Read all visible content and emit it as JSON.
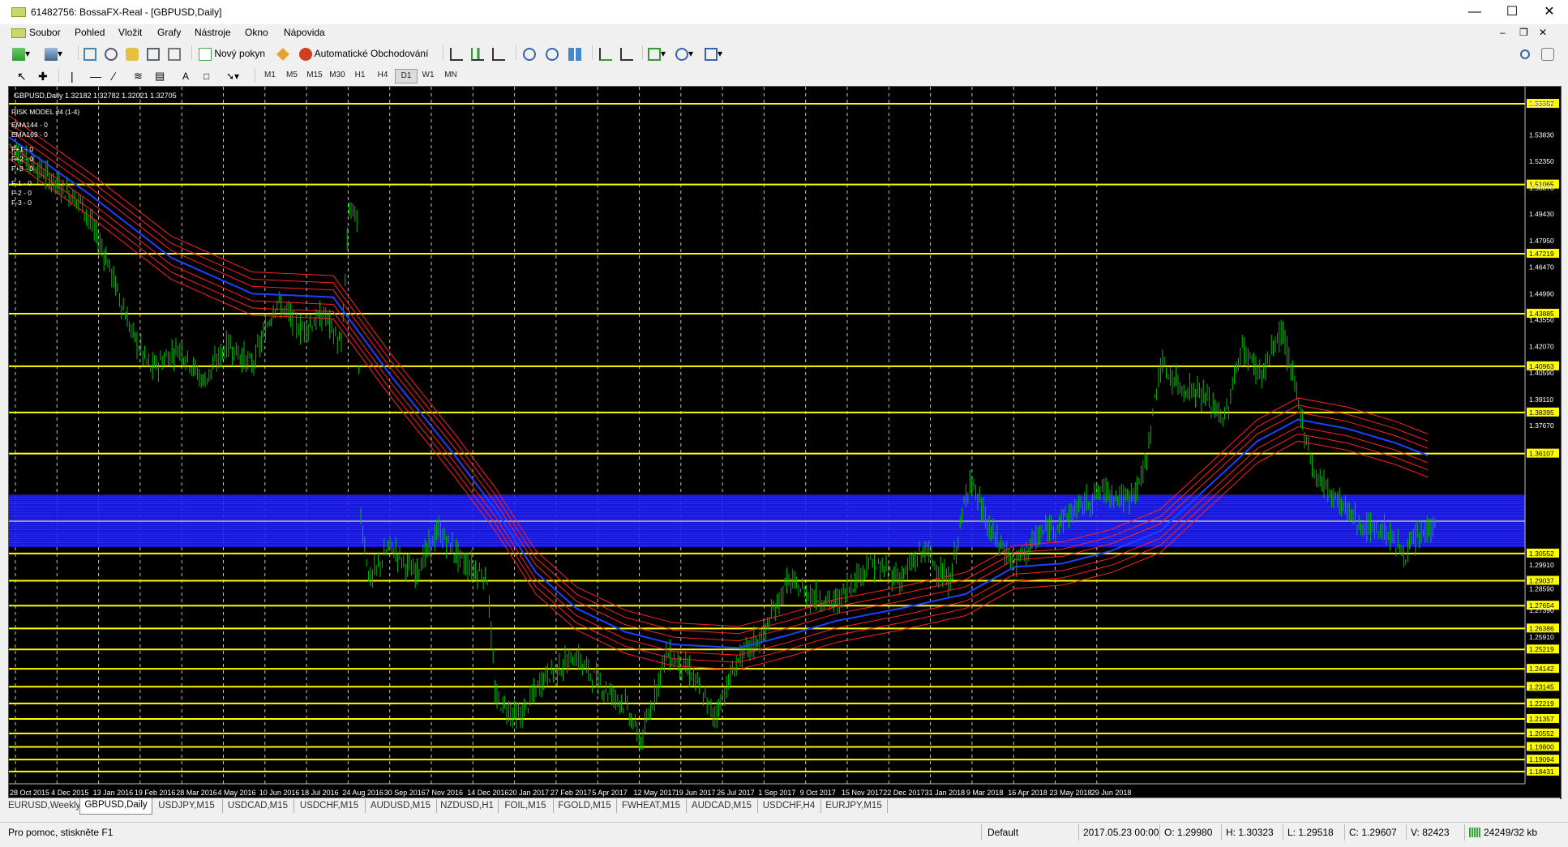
{
  "window": {
    "title": "61482756: BossaFX-Real - [GBPUSD,Daily]"
  },
  "menu": {
    "items": [
      "Soubor",
      "Pohled",
      "Vložit",
      "Grafy",
      "Nástroje",
      "Okno",
      "Nápovida"
    ]
  },
  "toolbar": {
    "new_order": "Nový pokyn",
    "auto_trading": "Automatické Obchodování"
  },
  "timeframes": [
    "M1",
    "M5",
    "M15",
    "M30",
    "H1",
    "H4",
    "D1",
    "W1",
    "MN"
  ],
  "active_timeframe": "D1",
  "chart": {
    "header": "GBPUSD,Daily  1.32182 1.32782 1.32021 1.32705",
    "indicators": [
      "RISK MODEL #4 (1-4)",
      "EMA144 - 0",
      "EMA169 - 0",
      "F+1 - 0",
      "F+2 - 0",
      "F+3 - 0",
      "F-1 - 0",
      "F-2 - 0",
      "F-3 - 0"
    ],
    "price_labels": [
      "1.55552",
      "1.55510",
      "1.53830",
      "1.52350",
      "1.51065",
      "1.50870",
      "1.49430",
      "1.47950",
      "1.47219",
      "1.46470",
      "1.44990",
      "1.43885",
      "1.43550",
      "1.42070",
      "1.40963",
      "1.40590",
      "1.39110",
      "1.38395",
      "1.37670",
      "1.36107",
      "1.30552",
      "1.29910",
      "1.29037",
      "1.28590",
      "1.27654",
      "1.27390",
      "1.26386",
      "1.25910",
      "1.25219",
      "1.24142",
      "1.23145",
      "1.22219",
      "1.21357",
      "1.20552",
      "1.19800",
      "1.19094",
      "1.18431"
    ],
    "date_labels": [
      "28 Oct 2015",
      "4 Dec 2015",
      "13 Jan 2016",
      "19 Feb 2016",
      "28 Mar 2016",
      "4 May 2016",
      "10 Jun 2016",
      "18 Jul 2016",
      "24 Aug 2016",
      "30 Sep 2016",
      "7 Nov 2016",
      "14 Dec 2016",
      "20 Jan 2017",
      "27 Feb 2017",
      "5 Apr 2017",
      "12 May 2017",
      "19 Jun 2017",
      "26 Jul 2017",
      "1 Sep 2017",
      "9 Oct 2017",
      "15 Nov 2017",
      "22 Dec 2017",
      "31 Jan 2018",
      "9 Mar 2018",
      "16 Apr 2018",
      "23 May 2018",
      "29 Jun 2018"
    ],
    "colors": {
      "background": "#000000",
      "candles": "#00c000",
      "levels": "#ffff00",
      "zone": "#1a1aff",
      "ema": "#ff2020",
      "ema_core": "#2040ff"
    }
  },
  "chart_tabs": [
    "EURUSD,Weekly",
    "GBPUSD,Daily",
    "USDJPY,M15",
    "USDCAD,M15",
    "USDCHF,M15",
    "AUDUSD,M15",
    "NZDUSD,H1",
    "FOIL,M15",
    "FGOLD,M15",
    "FWHEAT,M15",
    "AUDCAD,M15",
    "USDCHF,H4",
    "EURJPY,M15"
  ],
  "active_tab": "GBPUSD,Daily",
  "status": {
    "help": "Pro pomoc, stiskněte F1",
    "profile": "Default",
    "datetime": "2017.05.23 00:00",
    "open": "O: 1.29980",
    "high": "H: 1.30323",
    "low": "L: 1.29518",
    "close": "C: 1.29607",
    "volume": "V: 82423",
    "traffic": "24249/32 kb"
  }
}
